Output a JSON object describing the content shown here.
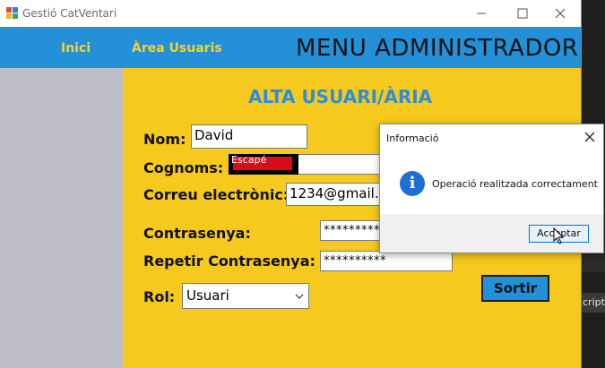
{
  "window": {
    "title": "Gestió CatVentari"
  },
  "nav": {
    "items": [
      {
        "label": "Inici"
      },
      {
        "label": "Àrea Usuaris"
      }
    ],
    "menu_title": "MENU ADMINISTRADOR"
  },
  "form": {
    "title": "ALTA USUARI/ÀRIA",
    "nom_label": "Nom:",
    "nom_value": "David",
    "cognoms_label": "Cognoms:",
    "cognoms_value": "Escapé",
    "correu_label": "Correu electrònic:",
    "correu_value": "1234@gmail.",
    "contrasenya_label": "Contrasenya:",
    "contrasenya_value": "**********",
    "repetir_label": "Repetir Contrasenya:",
    "repetir_value": "**********",
    "rol_label": "Rol:",
    "rol_value": "Usuari",
    "sortir_label": "Sortir"
  },
  "dialog": {
    "title": "Informació",
    "message": "Operació realitzada correctament",
    "ok_label": "Acceptar"
  },
  "background_window": {
    "partial_text": "cripti"
  },
  "colors": {
    "topbar": "#2490d8",
    "nav_text": "#f6d32a",
    "content_bg": "#f5c91e",
    "sidebar_bg": "#bdbdc6",
    "form_title": "#2e8fd6"
  }
}
